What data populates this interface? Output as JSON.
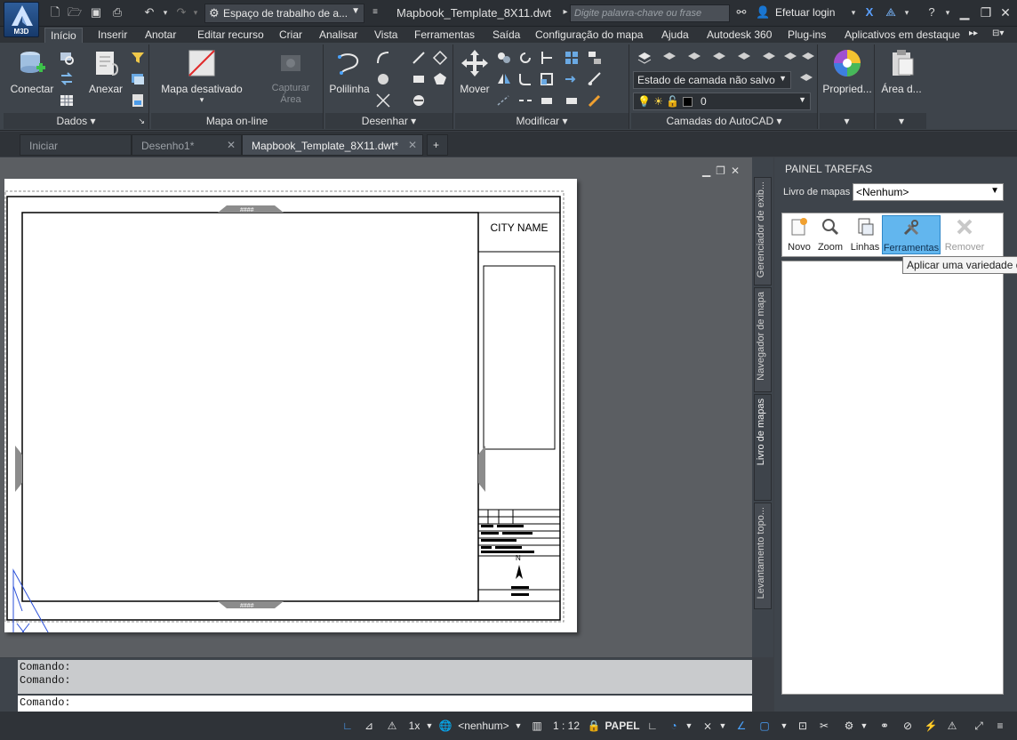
{
  "app": {
    "logo_label": "M3D",
    "workspace": "Espaço de trabalho de a...",
    "document_title": "Mapbook_Template_8X11.dwt",
    "search_placeholder": "Digite palavra-chave ou frase",
    "login": "Efetuar login"
  },
  "ribbon_tabs": [
    "Início",
    "Inserir",
    "Anotar",
    "Editar recurso",
    "Criar",
    "Analisar",
    "Vista",
    "Ferramentas",
    "Saída",
    "Configuração do mapa",
    "Ajuda",
    "Autodesk 360",
    "Plug-ins",
    "Aplicativos em destaque"
  ],
  "ribbon": {
    "conectar": "Conectar",
    "anexar": "Anexar",
    "mapa_desativado": "Mapa desativado",
    "capturar_area": "Capturar Área",
    "polilinha": "Polilinha",
    "mover": "Mover",
    "layer_state": "Estado de camada não salvo",
    "layer_name": "0",
    "propriedades": "Propried...",
    "area_d": "Área d...",
    "groups": {
      "dados": "Dados",
      "mapa_online": "Mapa on-line",
      "desenhar": "Desenhar",
      "modificar": "Modificar",
      "camadas": "Camadas do AutoCAD"
    }
  },
  "file_tabs": [
    {
      "label": "Iniciar"
    },
    {
      "label": "Desenho1*"
    },
    {
      "label": "Mapbook_Template_8X11.dwt*"
    }
  ],
  "drawing": {
    "city_name": "CITY NAME",
    "north_label": "N"
  },
  "task_panel": {
    "title": "PAINEL TAREFAS",
    "mapbook_label": "Livro de mapas",
    "mapbook_value": "<Nenhum>",
    "tools": [
      "Novo",
      "Zoom",
      "Linhas",
      "Ferramentas",
      "Remover"
    ],
    "tooltip": "Aplicar uma variedade d",
    "vertical_tabs": [
      "Gerenciador de exib...",
      "Navegador de mapa",
      "Livro de mapas",
      "Levantamento topo..."
    ]
  },
  "command": {
    "history": [
      "Comando:",
      "Comando:"
    ],
    "prompt": "Comando:"
  },
  "status": {
    "scale_factor": "1x",
    "coord_system": "<nenhum>",
    "annotation_scale": "1 : 12",
    "space": "PAPEL"
  },
  "colors": {
    "accent": "#4aa3ff",
    "selected_tool": "#62b6ee",
    "ribbon_bg": "#3e444b"
  }
}
